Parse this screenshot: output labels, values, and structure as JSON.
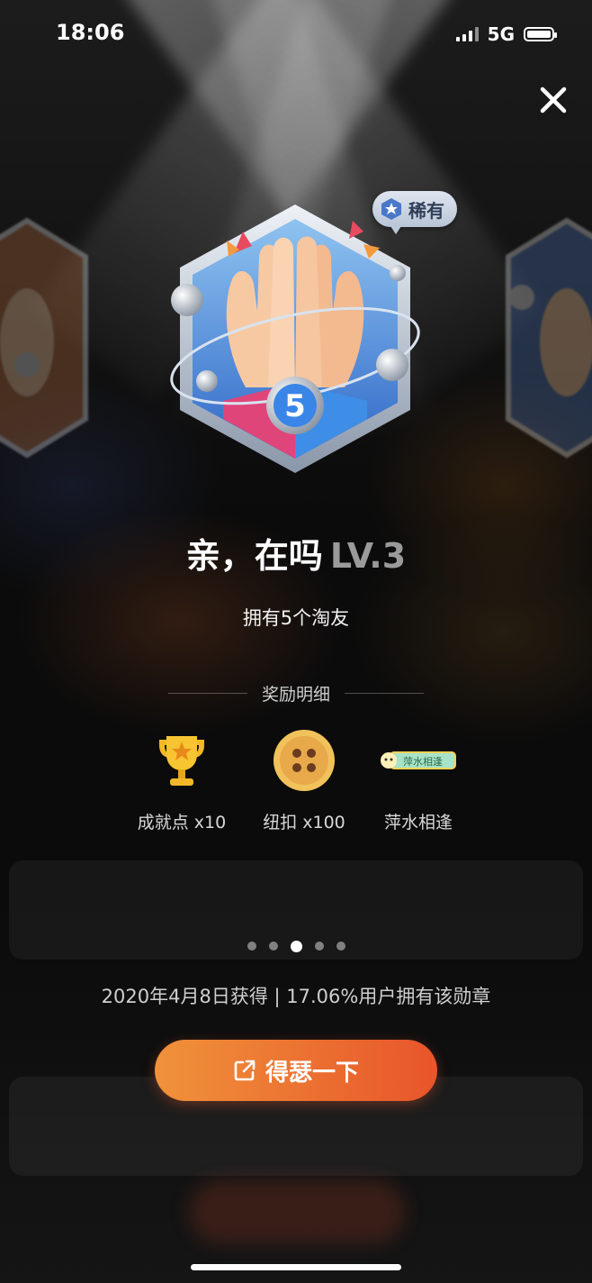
{
  "status_bar": {
    "time": "18:06",
    "network": "5G"
  },
  "badge": {
    "rarity": "稀有",
    "number": "5",
    "name": "亲，在吗",
    "level": "LV.3",
    "description": "拥有5个淘友"
  },
  "rewards": {
    "header": "奖励明细",
    "items": [
      {
        "label": "成就点 x10",
        "icon": "trophy-icon"
      },
      {
        "label": "纽扣 x100",
        "icon": "button-coin-icon"
      },
      {
        "label": "萍水相逢",
        "icon": "title-tag-icon",
        "tag_text": "萍水相逢"
      }
    ]
  },
  "pager": {
    "count": 5,
    "active_index": 2
  },
  "footer": {
    "info": "2020年4月8日获得 | 17.06%用户拥有该勋章"
  },
  "action": {
    "label": "得瑟一下"
  },
  "colors": {
    "accent_start": "#f0923a",
    "accent_end": "#e8552a",
    "level_gray": "#9a9a9a"
  }
}
